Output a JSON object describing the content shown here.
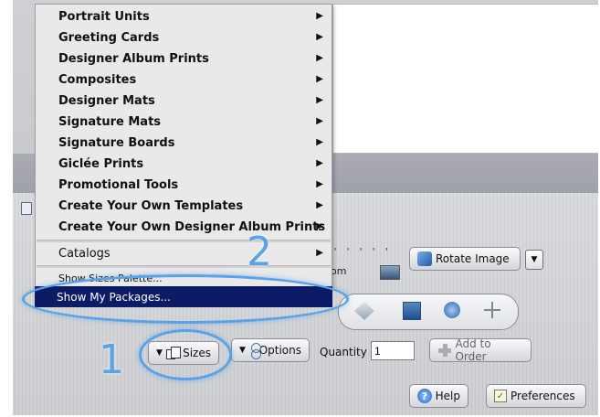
{
  "menu": {
    "items": [
      {
        "label": "Portrait Units",
        "submenu": true
      },
      {
        "label": "Greeting Cards",
        "submenu": true
      },
      {
        "label": "Designer Album Prints",
        "submenu": true
      },
      {
        "label": "Composites",
        "submenu": true
      },
      {
        "label": "Designer Mats",
        "submenu": true
      },
      {
        "label": "Signature Mats",
        "submenu": true
      },
      {
        "label": "Signature Boards",
        "submenu": true
      },
      {
        "label": "Giclée Prints",
        "submenu": true
      },
      {
        "label": "Promotional Tools",
        "submenu": true
      },
      {
        "label": "Create Your Own Templates",
        "submenu": true
      },
      {
        "label": "Create Your Own Designer Album Prints",
        "submenu": true
      }
    ],
    "catalogs": "Catalogs",
    "show_sizes_palette": "Show Sizes Palette...",
    "show_my_packages": "Show My Packages..."
  },
  "toolbar": {
    "rotate_image": "Rotate Image",
    "sizes": "Sizes",
    "options": "Options",
    "quantity_label": "Quantity",
    "quantity_value": "1",
    "add_to_order": "Add to Order",
    "help": "Help",
    "preferences": "Preferences",
    "zoom_partial_label": "om"
  },
  "annotations": {
    "step1": "1",
    "step2": "2"
  },
  "colors": {
    "highlight": "#0c1b66",
    "callout": "#5aa3e6"
  }
}
